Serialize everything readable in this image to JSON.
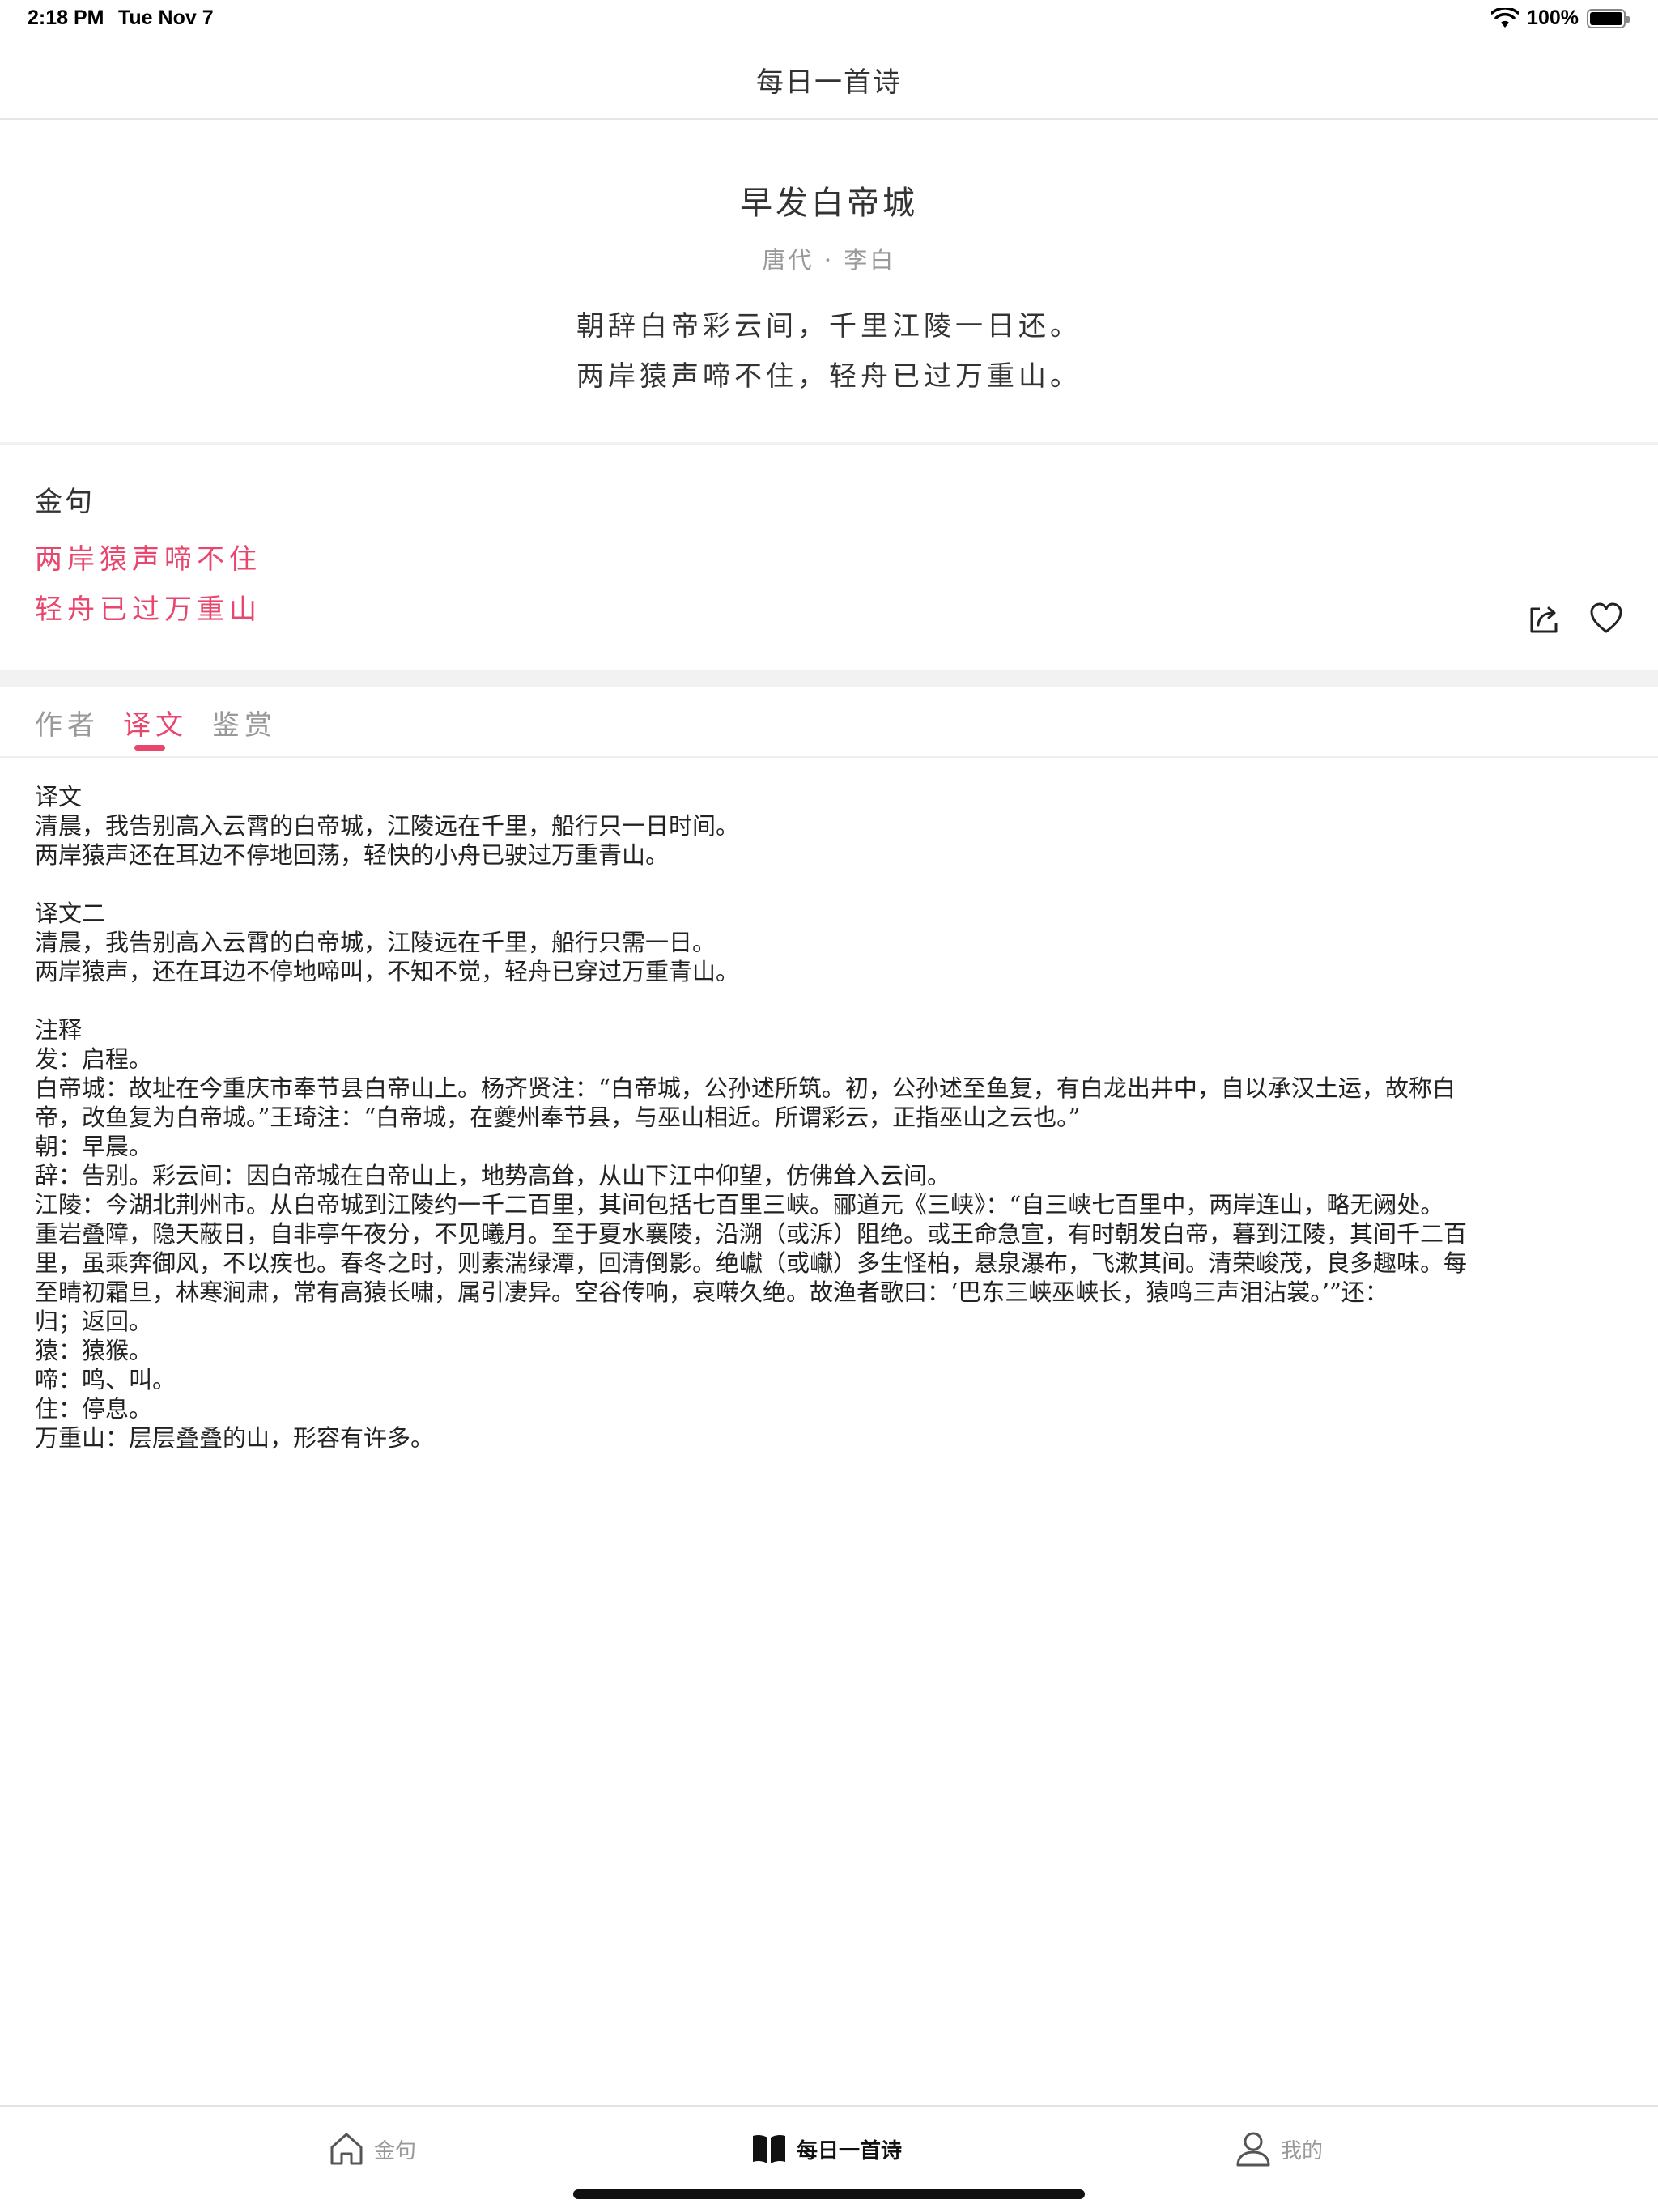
{
  "status_bar": {
    "time": "2:18 PM",
    "date": "Tue Nov 7",
    "battery": "100%"
  },
  "nav": {
    "title": "每日一首诗"
  },
  "poem": {
    "title": "早发白帝城",
    "author": "唐代 · 李白",
    "lines": [
      "朝辞白帝彩云间，千里江陵一日还。",
      "两岸猿声啼不住，轻舟已过万重山。"
    ]
  },
  "golden": {
    "title": "金句",
    "lines": [
      "两岸猿声啼不住",
      "轻舟已过万重山"
    ],
    "accent_color": "#e8466d",
    "share_icon": "share-icon",
    "like_icon": "heart-icon"
  },
  "tabs": {
    "items": [
      "作者",
      "译文",
      "鉴赏"
    ],
    "active": "译文"
  },
  "content": {
    "lines": [
      "译文",
      "清晨，我告别高入云霄的白帝城，江陵远在千里，船行只一日时间。",
      "两岸猿声还在耳边不停地回荡，轻快的小舟已驶过万重青山。",
      "",
      "译文二",
      "清晨，我告别高入云霄的白帝城，江陵远在千里，船行只需一日。",
      "两岸猿声，还在耳边不停地啼叫，不知不觉，轻舟已穿过万重青山。",
      "",
      "注释",
      "发：启程。",
      "白帝城：故址在今重庆市奉节县白帝山上。杨齐贤注：“白帝城，公孙述所筑。初，公孙述至鱼复，有白龙出井中，自以承汉土运，故称白",
      "帝，改鱼复为白帝城。”王琦注：“白帝城，在夔州奉节县，与巫山相近。所谓彩云，正指巫山之云也。”",
      "朝：早晨。",
      "辞：告别。彩云间：因白帝城在白帝山上，地势高耸，从山下江中仰望，仿佛耸入云间。",
      "江陵：今湖北荆州市。从白帝城到江陵约一千二百里，其间包括七百里三峡。郦道元《三峡》：“自三峡七百里中，两岸连山，略无阙处。",
      "重岩叠障，隐天蔽日，自非亭午夜分，不见曦月。至于夏水襄陵，沿溯（或泝）阻绝。或王命急宣，有时朝发白帝，暮到江陵，其间千二百",
      "里，虽乘奔御风，不以疾也。春冬之时，则素湍绿潭，回清倒影。绝巘（或𪩘）多生怪柏，悬泉瀑布，飞漱其间。清荣峻茂，良多趣味。每",
      "至晴初霜旦，林寒涧肃，常有高猿长啸，属引凄异。空谷传响，哀啭久绝。故渔者歌曰：‘巴东三峡巫峡长，猿鸣三声泪沾裳。’”还：",
      "归；返回。",
      "猿：猿猴。",
      "啼：鸣、叫。",
      "住：停息。",
      "万重山：层层叠叠的山，形容有许多。"
    ]
  },
  "tab_bar": {
    "items": [
      {
        "label": "金句",
        "icon": "home-icon"
      },
      {
        "label": "每日一首诗",
        "icon": "book-icon"
      },
      {
        "label": "我的",
        "icon": "person-icon"
      }
    ],
    "active": "每日一首诗"
  }
}
